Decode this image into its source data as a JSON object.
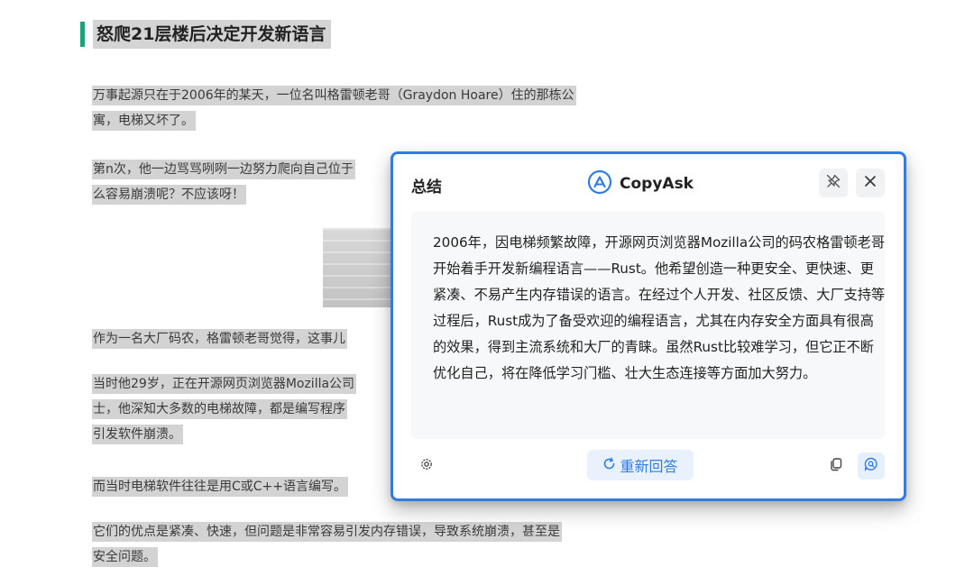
{
  "article": {
    "title": "怒爬21层楼后决定开发新语言",
    "paragraphs": [
      [
        "万事起源只在于2006年的某天，一位名叫格雷顿老哥（Graydon Hoare）住的那栋公",
        "寓，电梯又坏了。"
      ],
      [
        "第n次，他一边骂骂咧咧一边努力爬向自己位于",
        "么容易崩溃呢？不应该呀！"
      ],
      [
        "作为一名大厂码农，格雷顿老哥觉得，这事儿"
      ],
      [
        "当时他29岁，正在开源网页浏览器Mozilla公司",
        "士，他深知大多数的电梯故障，都是编写程序",
        "引发软件崩溃。"
      ],
      [
        "而当时电梯软件往往是用C或C++语言编写。"
      ],
      [
        "它们的优点是紧凑、快速，但问题是非常容易引发内存错误，导致系统崩溃，甚至是",
        "安全问题。"
      ]
    ]
  },
  "popup": {
    "title": "总结",
    "brand_name": "CopyAsk",
    "summary": "2006年，因电梯频繁故障，开源网页浏览器Mozilla公司的码农格雷顿老哥开始着手开发新编程语言——Rust。他希望创造一种更安全、更快速、更紧凑、不易产生内存错误的语言。在经过个人开发、社区反馈、大厂支持等过程后，Rust成为了备受欢迎的编程语言，尤其在内存安全方面具有很高的效果，得到主流系统和大厂的青睐。虽然Rust比较难学习，但它正不断优化自己，将在降低学习门槛、壮大生态连接等方面加大努力。",
    "regenerate_label": "重新回答"
  },
  "icons": {
    "brand": "copyask-logo-icon",
    "pin": "unpin-icon",
    "close": "close-icon",
    "settings": "gear-icon",
    "regenerate": "refresh-icon",
    "copy": "copy-icon",
    "ask": "chat-search-icon"
  },
  "colors": {
    "accent_green": "#1aa37a",
    "popup_border": "#2f7de1",
    "highlight": "#d3d3d3"
  }
}
